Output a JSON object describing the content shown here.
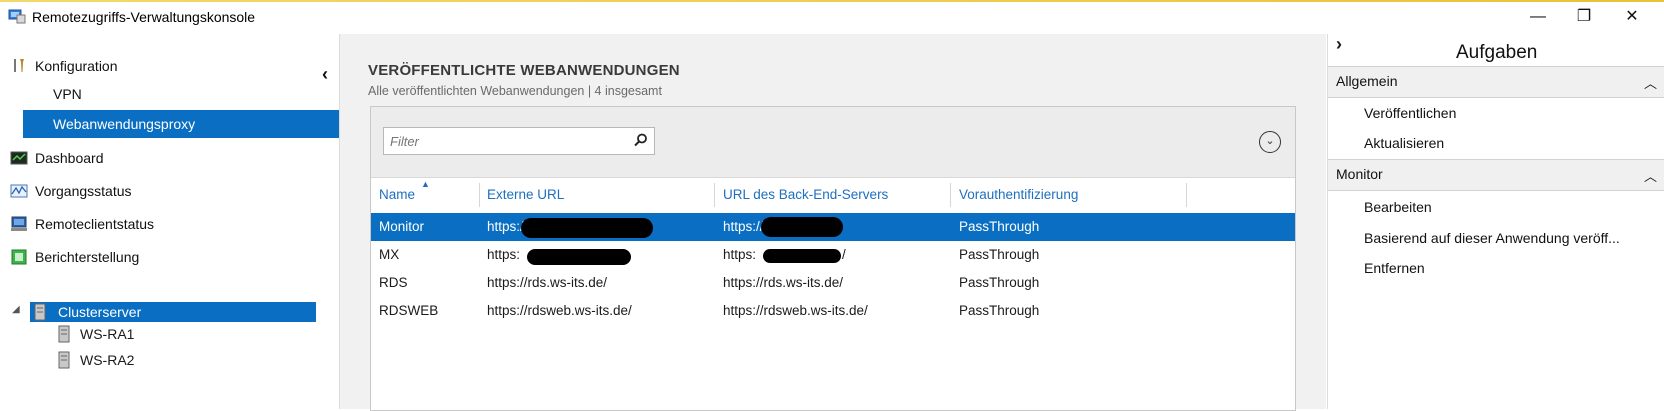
{
  "window": {
    "title": "Remotezugriffs-Verwaltungskonsole",
    "minimize": "—",
    "maximize": "❐",
    "close": "✕"
  },
  "left_nav": {
    "collapse_glyph": "‹",
    "items": [
      {
        "label": "Konfiguration",
        "icon": "tools-icon"
      },
      {
        "label": "VPN"
      },
      {
        "label": "Webanwendungsproxy",
        "selected": true
      },
      {
        "label": "Dashboard",
        "icon": "dashboard-icon"
      },
      {
        "label": "Vorgangsstatus",
        "icon": "chart-icon"
      },
      {
        "label": "Remoteclientstatus",
        "icon": "computer-icon"
      },
      {
        "label": "Berichterstellung",
        "icon": "report-icon"
      }
    ],
    "tree": {
      "root": "Clusterserver",
      "children": [
        "WS-RA1",
        "WS-RA2"
      ]
    }
  },
  "main": {
    "heading": "VERÖFFENTLICHTE WEBANWENDUNGEN",
    "subheading": "Alle veröffentlichten Webanwendungen | 4 insgesamt",
    "filter_placeholder": "Filter",
    "columns": [
      "Name",
      "Externe URL",
      "URL des Back-End-Servers",
      "Vorauthentifizierung"
    ],
    "rows": [
      {
        "name": "Monitor",
        "external": "https://",
        "backend": "https://",
        "preauth": "PassThrough",
        "selected": true
      },
      {
        "name": "MX",
        "external": "https:",
        "backend": "https:",
        "preauth": "PassThrough"
      },
      {
        "name": "RDS",
        "external": "https://rds.ws-its.de/",
        "backend": "https://rds.ws-its.de/",
        "preauth": "PassThrough"
      },
      {
        "name": "RDSWEB",
        "external": "https://rdsweb.ws-its.de/",
        "backend": "https://rdsweb.ws-its.de/",
        "preauth": "PassThrough"
      }
    ],
    "mx_backend_tail": "/"
  },
  "tasks": {
    "expand_glyph": "›",
    "title": "Aufgaben",
    "sections": [
      {
        "title": "Allgemein",
        "actions": [
          "Veröffentlichen",
          "Aktualisieren"
        ]
      },
      {
        "title": "Monitor",
        "actions": [
          "Bearbeiten",
          "Basierend auf dieser Anwendung veröff...",
          "Entfernen"
        ]
      }
    ]
  },
  "colors": {
    "accent": "#0A6FC2",
    "link": "#1E6FBF"
  }
}
